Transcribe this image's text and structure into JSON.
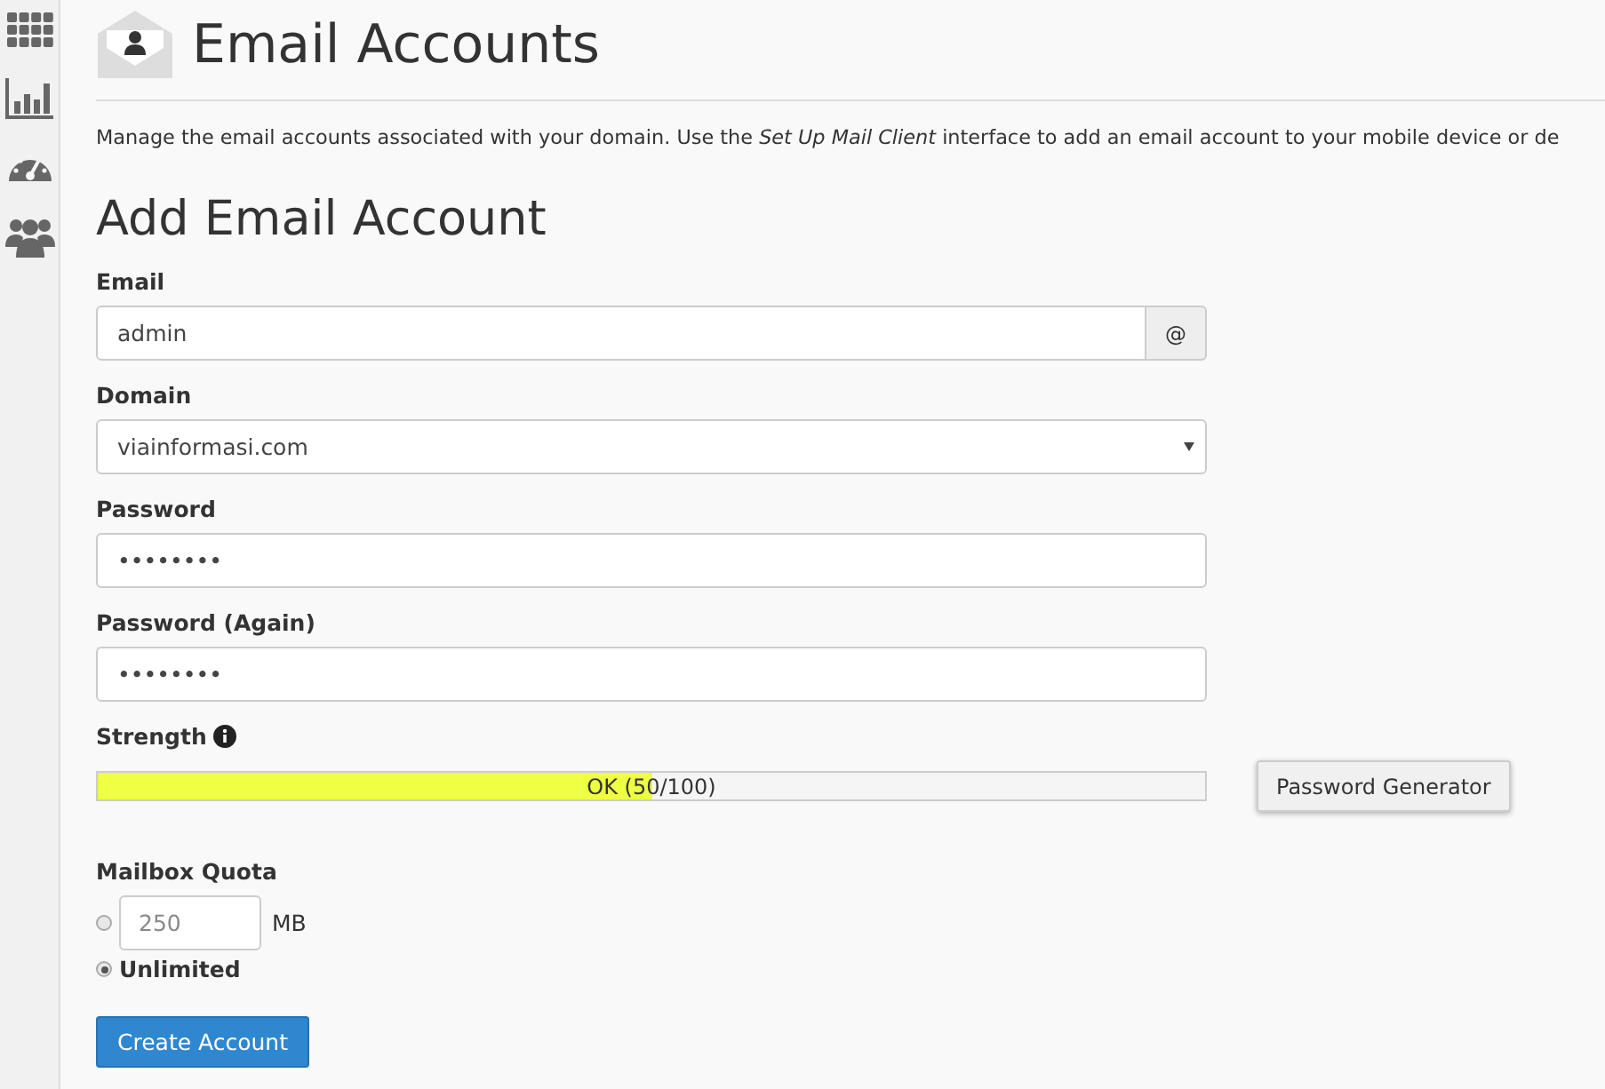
{
  "sidebar": {
    "items": [
      {
        "kind": "grid"
      },
      {
        "kind": "chart"
      },
      {
        "kind": "gauge"
      },
      {
        "kind": "users"
      }
    ]
  },
  "page": {
    "title": "Email Accounts",
    "description": "Manage the email accounts associated with your domain. Use the *Set Up Mail Client* interface to add an email account to your mobile device or de"
  },
  "form": {
    "title": "Add Email Account",
    "email": {
      "label": "Email",
      "value": "admin",
      "addon": "@"
    },
    "domain": {
      "label": "Domain",
      "value": "viainformasi.com"
    },
    "password": {
      "label": "Password",
      "value": "••••••••"
    },
    "password_again": {
      "label": "Password (Again)",
      "value": "••••••••"
    },
    "strength": {
      "label": "Strength",
      "level": 0.5,
      "reading": "OK (50/100)",
      "generator_button": "Password Generator"
    },
    "quota": {
      "label": "Mailbox Quota",
      "options": [
        {
          "kind": "custom",
          "selected": false,
          "placeholder": "250",
          "unit": "MB"
        },
        {
          "kind": "unlimited",
          "selected": true,
          "label": "Unlimited"
        }
      ]
    },
    "submit": "Create Account"
  }
}
